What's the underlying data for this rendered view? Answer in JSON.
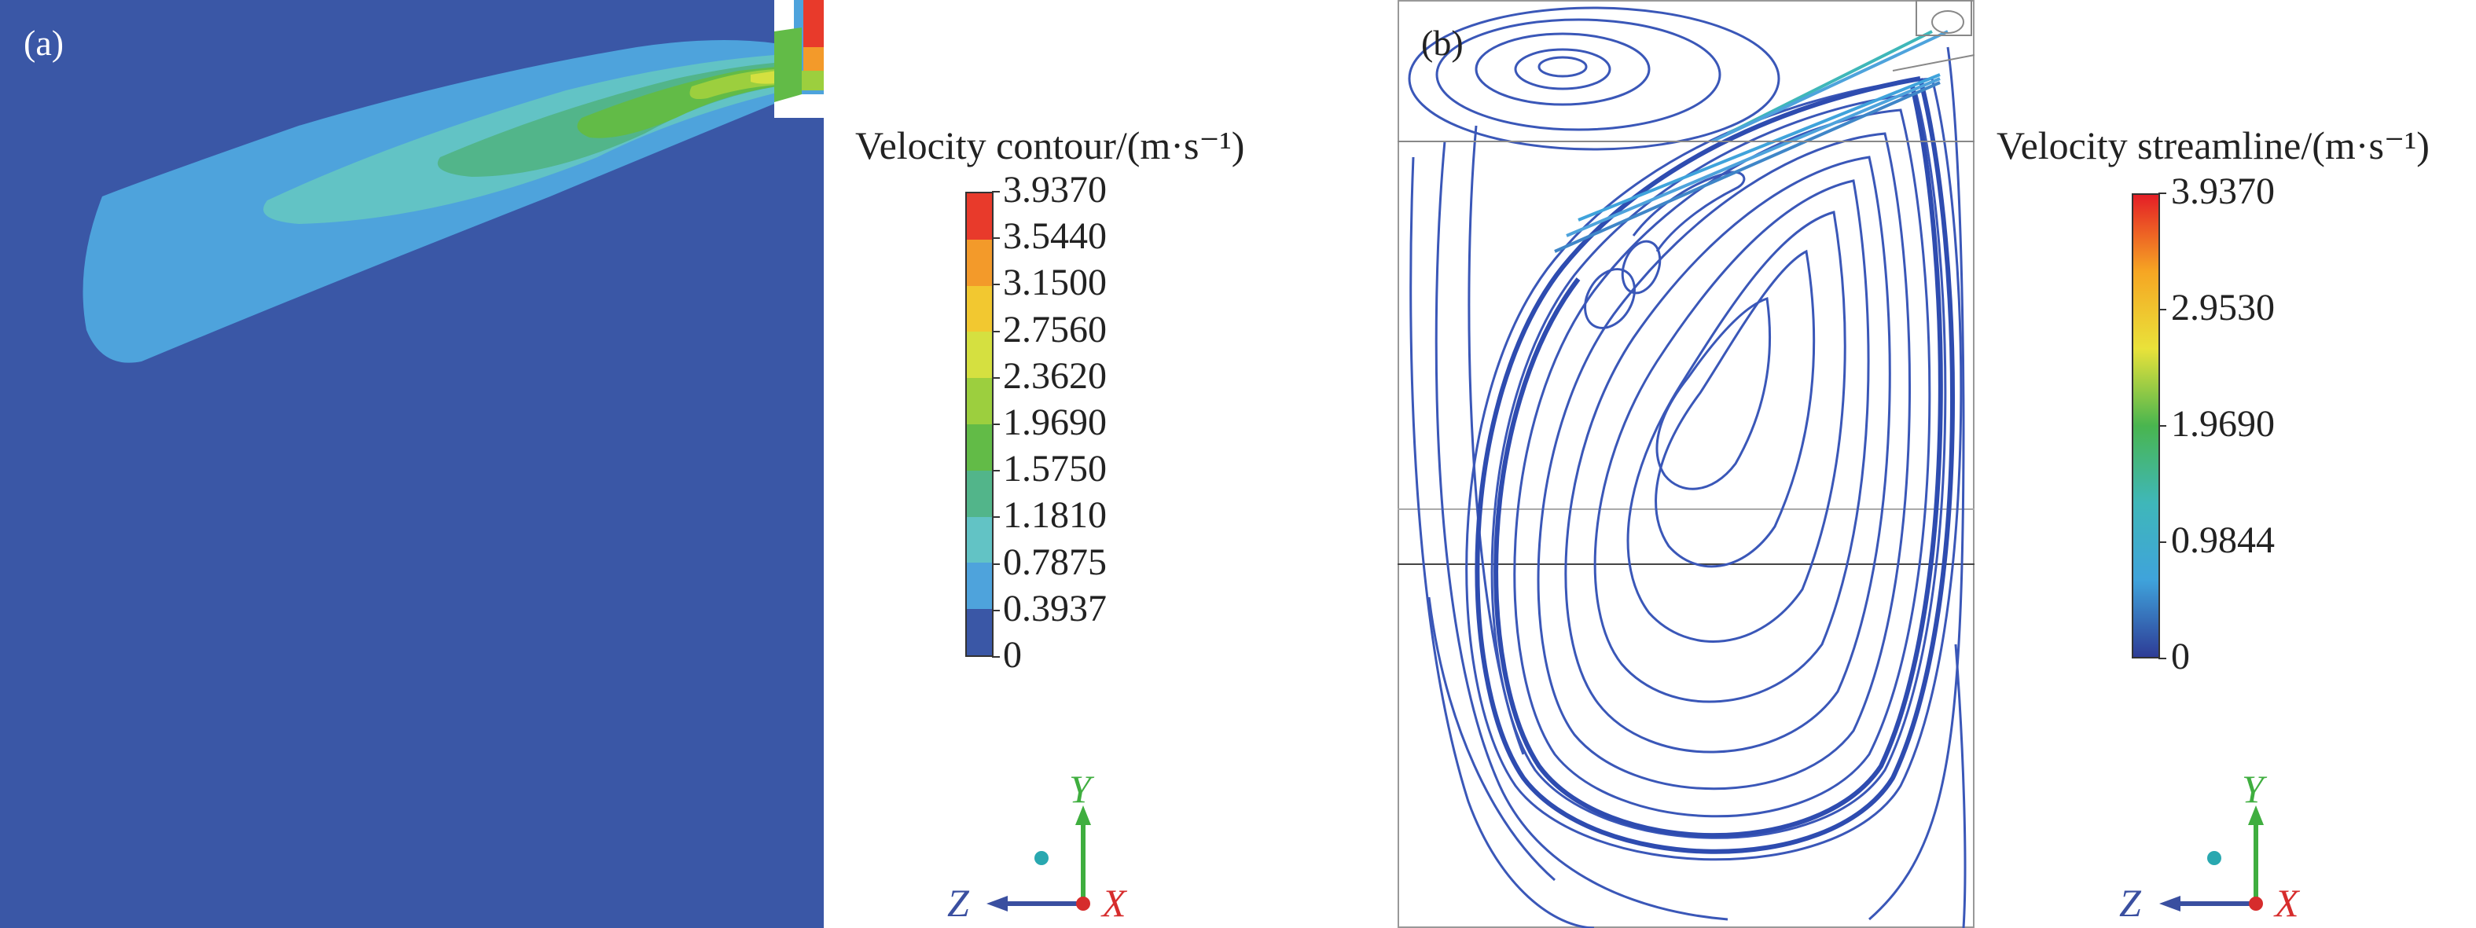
{
  "panel_a": {
    "label": "(a)",
    "background_color": "#3a57a6",
    "legend": {
      "title": "Velocity contour/(m·s⁻¹)",
      "ticks": [
        "3.9370",
        "3.5440",
        "3.1500",
        "2.7560",
        "2.3620",
        "1.9690",
        "1.5750",
        "1.1810",
        "0.7875",
        "0.3937",
        "0"
      ],
      "band_colors": [
        "#e83a2b",
        "#f39a2a",
        "#f2c830",
        "#d5e040",
        "#9ccf3e",
        "#62bb47",
        "#52b58a",
        "#62c3c5",
        "#4ea3dc",
        "#3a57a6"
      ]
    }
  },
  "panel_b": {
    "label": "(b)",
    "streamline_color": "#3a57b8",
    "legend": {
      "title": "Velocity streamline/(m·s⁻¹)",
      "ticks": [
        "3.9370",
        "2.9530",
        "1.9690",
        "0.9844",
        "0"
      ],
      "gradient_colors": [
        "#e41e26",
        "#f6a623",
        "#e9e23a",
        "#49b54f",
        "#3fb7b9",
        "#3fa3db",
        "#2e3c96"
      ]
    }
  },
  "axes_triad": {
    "y": {
      "label": "Y",
      "color": "#3fae3f"
    },
    "z": {
      "label": "Z",
      "color": "#3a4fa0"
    },
    "x": {
      "label": "X",
      "color": "#d62c2c"
    },
    "dot_color": "#29a8b0"
  }
}
